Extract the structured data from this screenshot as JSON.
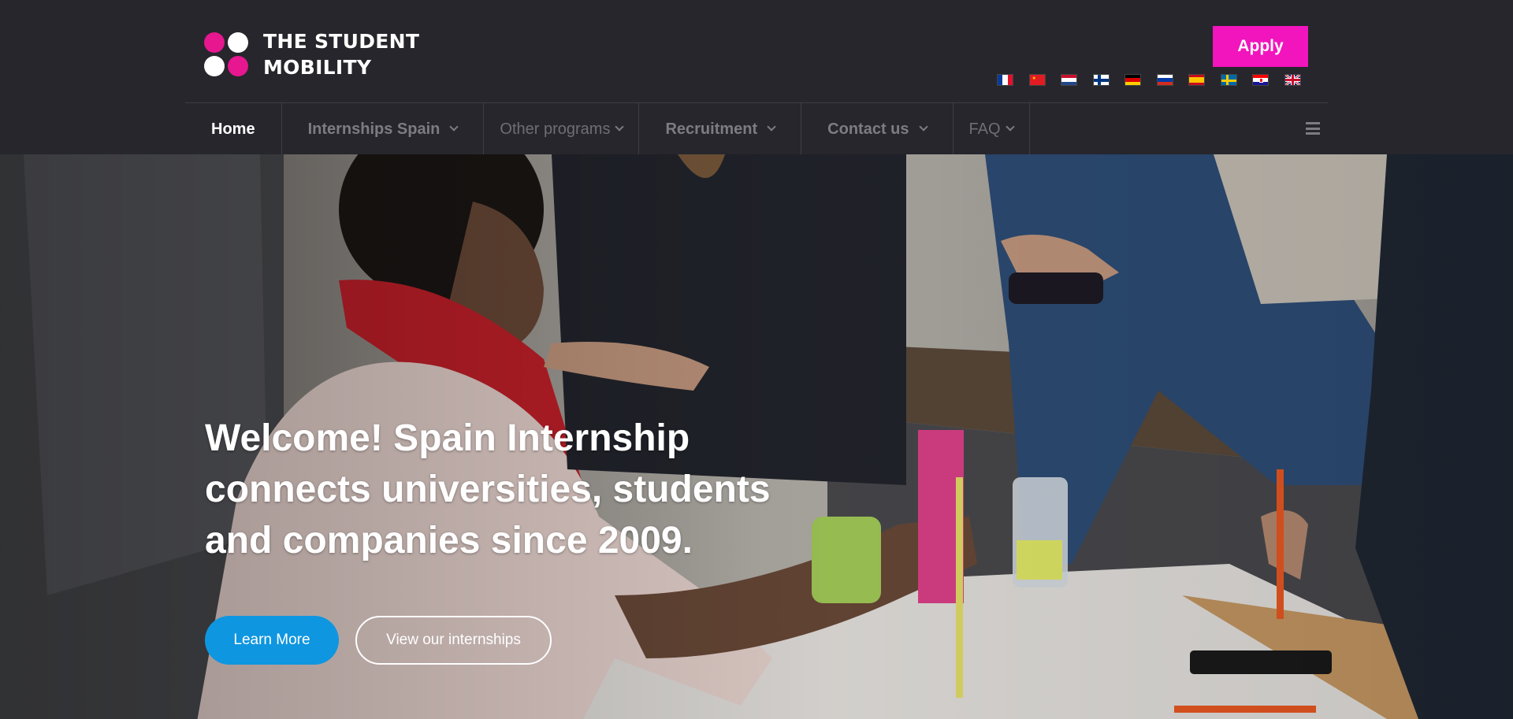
{
  "brand": {
    "line1": "THE STUDENT",
    "line2": "MOBILITY",
    "pink": "#e6178f"
  },
  "header": {
    "apply_label": "Apply",
    "apply_color": "#f214bd",
    "flags": [
      {
        "icon": "flag-france-icon"
      },
      {
        "icon": "flag-china-icon"
      },
      {
        "icon": "flag-netherlands-icon"
      },
      {
        "icon": "flag-finland-icon"
      },
      {
        "icon": "flag-germany-icon"
      },
      {
        "icon": "flag-russia-icon"
      },
      {
        "icon": "flag-spain-icon"
      },
      {
        "icon": "flag-sweden-icon"
      },
      {
        "icon": "flag-croatia-icon"
      },
      {
        "icon": "flag-uk-icon"
      }
    ]
  },
  "nav": {
    "items": [
      {
        "label": "Home"
      },
      {
        "label": "Internships Spain"
      },
      {
        "label": "Other programs"
      },
      {
        "label": "Recruitment"
      },
      {
        "label": "Contact us"
      },
      {
        "label": "FAQ"
      }
    ],
    "menu_icon": "hamburger-menu-icon"
  },
  "hero": {
    "title": "Welcome! Spain Internship connects universities, students and companies since 2009.",
    "learn_more_label": "Learn More",
    "view_internships_label": "View our internships",
    "learn_more_color": "#0f96e0"
  }
}
